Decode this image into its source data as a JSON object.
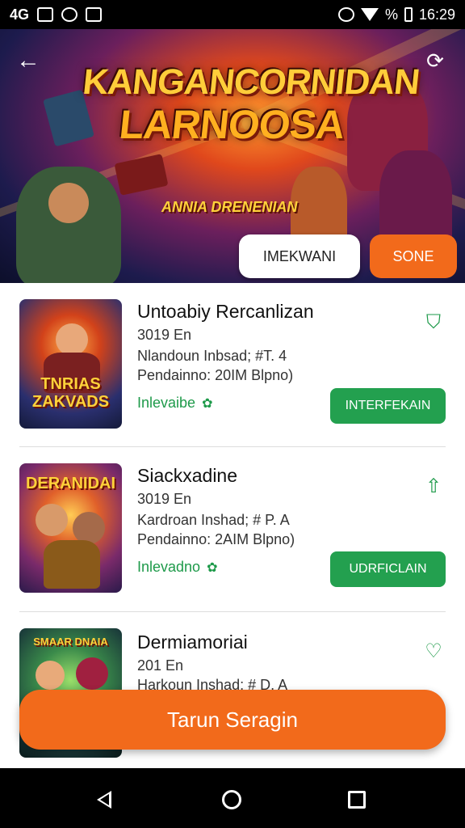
{
  "status_bar": {
    "carrier_text": "4G",
    "battery_text": "%",
    "time": "16:29"
  },
  "hero": {
    "title_line1": "KANGANCORNIDAN",
    "title_line2": "LARNOOSA",
    "subtitle": "ANNIA DRENENIAN",
    "white_button": "IMEKWANI",
    "orange_button": "SONE"
  },
  "items": [
    {
      "thumb_title": "TNRIAS ZAKVADS",
      "title": "Untoabiy Rercanlizan",
      "subtitle": "3019 En",
      "line1": "Nlandoun Inbsad; #T. 4",
      "line2": "Pendainno: 20IM  Blpno)",
      "status": "Inlevaibe",
      "button": "INTERFEKAIN"
    },
    {
      "thumb_title": "DERANIDAI",
      "title": "Siackxadine",
      "subtitle": "3019 En",
      "line1": "Kardroan Inshad; # P. A",
      "line2": "Pendainno: 2AIM  Blpno)",
      "status": "Inlevadno",
      "button": "UDRFICLAIN"
    },
    {
      "thumb_title": "SMAAR DNAIA",
      "title": "Dermiamoriai",
      "subtitle": "201 En",
      "line1": "Harkoun Inshad; # D. A",
      "line2": "",
      "status": "",
      "button": ""
    }
  ],
  "cta": {
    "label": "Tarun Seragin"
  },
  "colors": {
    "accent_orange": "#f26a1b",
    "accent_green": "#23a04f"
  }
}
